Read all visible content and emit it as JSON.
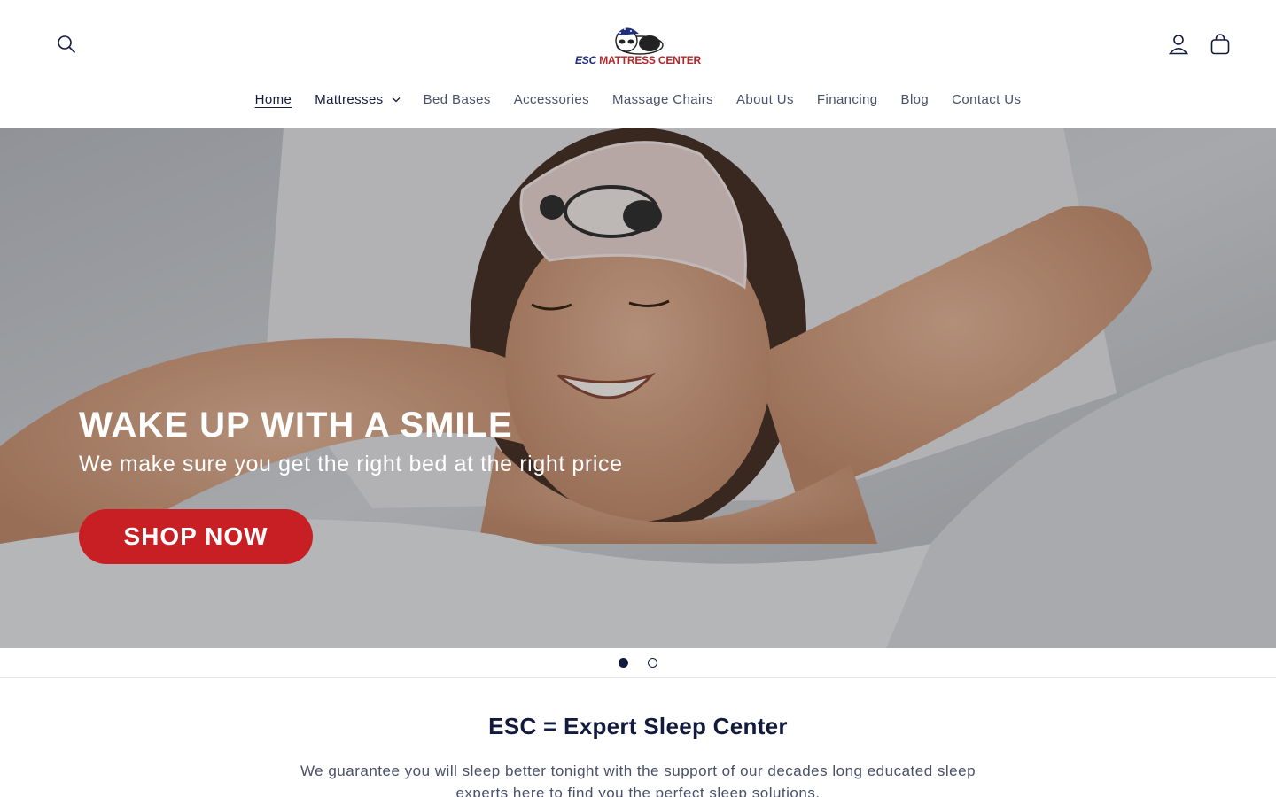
{
  "header": {
    "logo": {
      "esc": "ESC",
      "rest": "MATTRESS CENTER"
    },
    "icons": {
      "search": "search-icon",
      "account": "user-icon",
      "cart": "cart-icon"
    }
  },
  "nav": {
    "items": [
      {
        "label": "Home"
      },
      {
        "label": "Mattresses"
      },
      {
        "label": "Bed Bases"
      },
      {
        "label": "Accessories"
      },
      {
        "label": "Massage Chairs"
      },
      {
        "label": "About Us"
      },
      {
        "label": "Financing"
      },
      {
        "label": "Blog"
      },
      {
        "label": "Contact Us"
      }
    ]
  },
  "hero": {
    "title": "WAKE UP WITH A SMILE",
    "subtitle": "We make sure you get the right bed at the right price",
    "button": "SHOP NOW",
    "button_color": "#c81f24"
  },
  "slider": {
    "slide_count": 2,
    "active_slide": 1
  },
  "intro": {
    "title": "ESC = Expert Sleep Center",
    "text": "We guarantee you will sleep better tonight with the support of our decades long educated sleep experts here to find you the perfect sleep solutions."
  }
}
